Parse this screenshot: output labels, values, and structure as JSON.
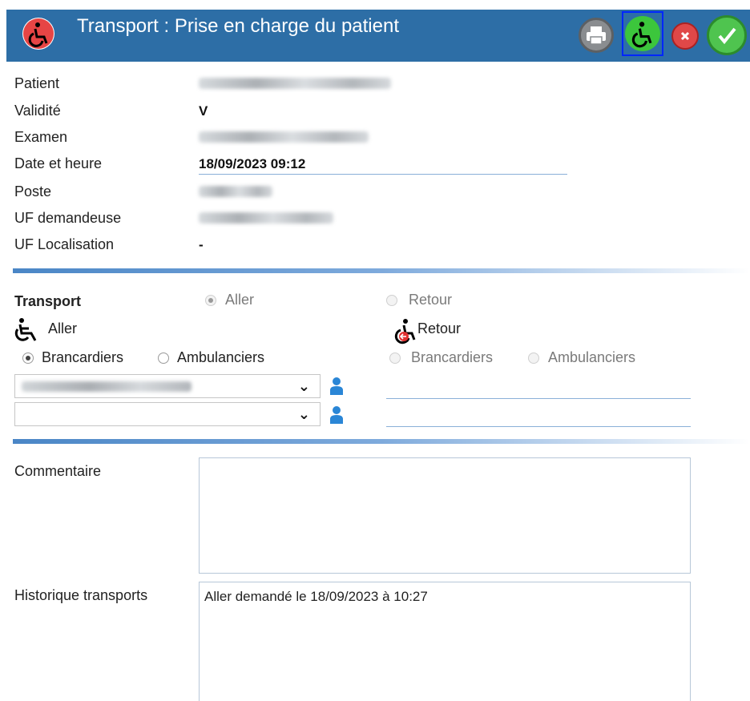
{
  "window": {
    "title": "Transport : Prise en charge du patient",
    "icons": [
      "wheelchair-icon",
      "print-icon",
      "wheelchair-icon",
      "close-icon",
      "check-icon"
    ],
    "colors": {
      "titlebar": "#2d6ea6",
      "wheelchair_active": "#3cc63c",
      "cancel": "#e04848",
      "ok": "#4fc44f"
    }
  },
  "info": {
    "patient_label": "Patient",
    "validite_label": "Validité",
    "validite_value": "V",
    "examen_label": "Examen",
    "date_label": "Date et heure",
    "date_value": "18/09/2023 09:12",
    "poste_label": "Poste",
    "uf_dem_label": "UF demandeuse",
    "uf_loc_label": "UF Localisation",
    "uf_loc_value": "-"
  },
  "transport": {
    "section_label": "Transport",
    "option_aller": "Aller",
    "option_retour": "Retour",
    "selected": "Aller",
    "aller_label": "Aller",
    "retour_label": "Retour",
    "aller_brancardiers": "Brancardiers",
    "aller_ambulanciers": "Ambulanciers",
    "aller_selected": "Brancardiers",
    "retour_brancardiers": "Brancardiers",
    "retour_ambulanciers": "Ambulanciers"
  },
  "comment": {
    "label": "Commentaire",
    "value": ""
  },
  "history": {
    "label": "Historique transports",
    "value": "Aller demandé le 18/09/2023 à 10:27"
  }
}
